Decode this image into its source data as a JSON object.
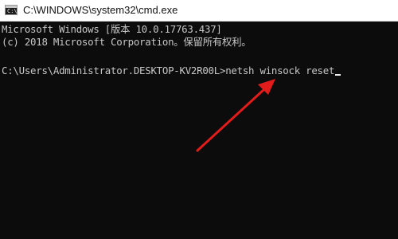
{
  "window": {
    "title": "C:\\WINDOWS\\system32\\cmd.exe",
    "icon": "cmd-icon",
    "icon_glyph": "C:\\"
  },
  "console": {
    "line1": "Microsoft Windows [版本 10.0.17763.437]",
    "line2": "(c) 2018 Microsoft Corporation。保留所有权利。",
    "prompt": "C:\\Users\\Administrator.DESKTOP-KV2R00L>",
    "command": "netsh winsock reset"
  },
  "colors": {
    "console_bg": "#0c0c0c",
    "console_text": "#c7c7c7",
    "annotation_arrow": "#e21b1b"
  },
  "annotation": {
    "type": "arrow",
    "icon": "red-arrow-icon"
  }
}
